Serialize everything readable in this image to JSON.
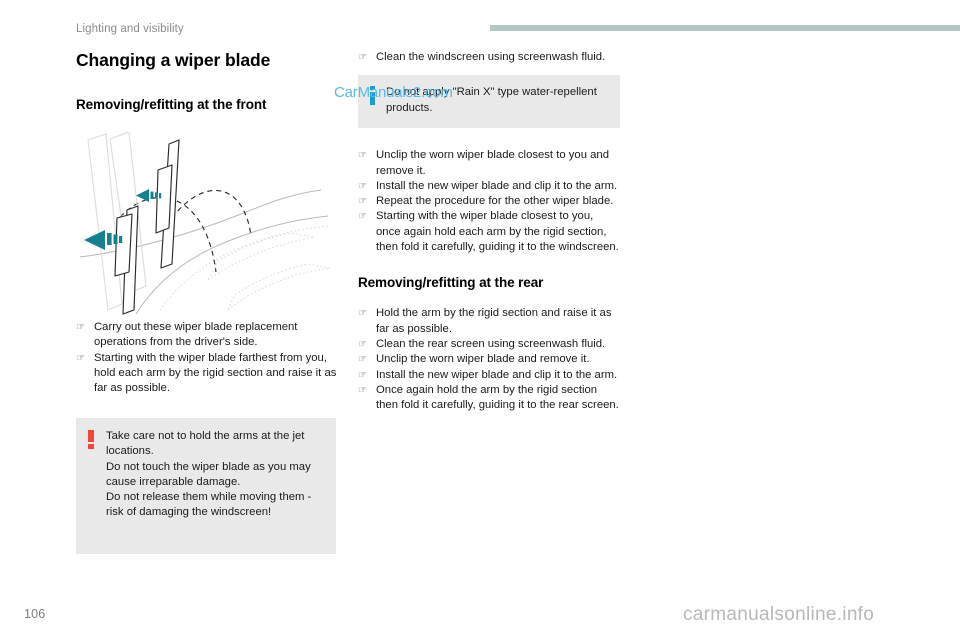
{
  "header": {
    "chapter_title": "Lighting and visibility",
    "rule_color": "#b2c6c3"
  },
  "left_column": {
    "h1_title": "Changing a wiper blade",
    "h2_title": "Removing/refitting at the front",
    "illustration_name": "front-wiper-arms-raised-diagram",
    "illustration_arrow_color": "#17808f",
    "steps": [
      "Carry out these wiper blade replacement operations from the driver's side.",
      "Starting with the wiper blade farthest from you, hold each arm by the rigid section and raise it as far as possible."
    ],
    "warning": {
      "icon": "exclamation-icon",
      "icon_color": "#f0463c",
      "lines": [
        "Take care not to hold the arms at the jet locations.",
        "Do not touch the wiper blade as you may cause irreparable damage.",
        "Do not release them while moving them - risk of damaging the windscreen!"
      ]
    }
  },
  "right_column": {
    "lead_steps": [
      "Clean the windscreen using screenwash fluid."
    ],
    "info": {
      "icon": "information-icon",
      "icon_color": "#1f9cd0",
      "lines": [
        "Do not apply \"Rain X\" type water-repellent products."
      ]
    },
    "front_steps": [
      "Unclip the worn wiper blade closest to you and remove it.",
      "Install the new wiper blade and clip it to the arm.",
      "Repeat the procedure for the other wiper blade.",
      "Starting with the wiper blade closest to you, once again hold each arm by the rigid section, then fold it carefully, guiding it to the windscreen."
    ],
    "h2_title": "Removing/refitting at the rear",
    "rear_steps": [
      "Hold the arm by the rigid section and raise it as far as possible.",
      "Clean the rear screen using screenwash fluid.",
      "Unclip the worn wiper blade and remove it.",
      "Install the new wiper blade and clip it to the arm.",
      "Once again hold the arm by the rigid section then fold it carefully, guiding it to the rear screen."
    ]
  },
  "bullet_glyph": "☞",
  "watermarks": {
    "top": "CarManuals2.com",
    "top_color": "#5bb9e8",
    "bottom": "carmanualsonline.info",
    "bottom_color": "#b8b8b8"
  },
  "footer": {
    "page_number": "106"
  }
}
